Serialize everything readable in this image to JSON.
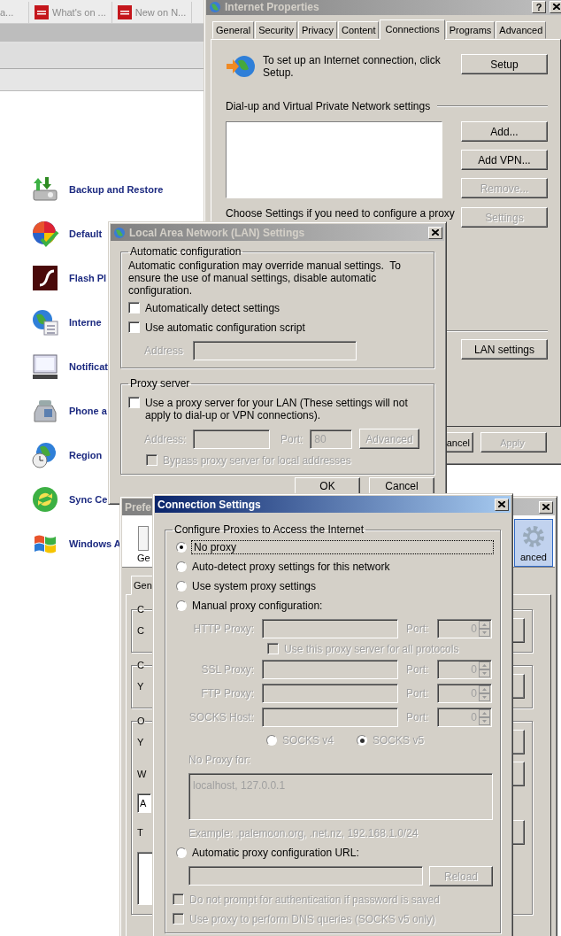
{
  "browser": {
    "tabs": [
      {
        "label": "a...",
        "has_icon": false
      },
      {
        "label": "What's on ...",
        "has_icon": true
      },
      {
        "label": "New on N...",
        "has_icon": true
      }
    ]
  },
  "control_panel": {
    "items": [
      {
        "label": "Backup and Restore"
      },
      {
        "label": "Default"
      },
      {
        "label": "Flash Pl"
      },
      {
        "label": "Interne"
      },
      {
        "label": "Notificat"
      },
      {
        "label": "Phone a"
      },
      {
        "label": "Region"
      },
      {
        "label": "Sync Ce"
      },
      {
        "label": "Windows A"
      }
    ]
  },
  "internet_properties": {
    "title": "Internet Properties",
    "help": "?",
    "active": false,
    "tabs": [
      {
        "label": "General",
        "selected": false
      },
      {
        "label": "Security",
        "selected": false
      },
      {
        "label": "Privacy",
        "selected": false
      },
      {
        "label": "Content",
        "selected": false
      },
      {
        "label": "Connections",
        "selected": true
      },
      {
        "label": "Programs",
        "selected": false
      },
      {
        "label": "Advanced",
        "selected": false
      }
    ],
    "setup_text": "To set up an Internet connection, click Setup.",
    "setup_button": "Setup",
    "vpn_heading": "Dial-up and Virtual Private Network settings",
    "vpn_buttons": [
      {
        "label": "Add...",
        "disabled": false
      },
      {
        "label": "Add VPN...",
        "disabled": false
      },
      {
        "label": "Remove...",
        "disabled": true
      }
    ],
    "proxy_text": "Choose Settings if you need to configure a proxy",
    "settings_button": {
      "label": "Settings",
      "disabled": true
    },
    "lan_button": "LAN settings",
    "footer_buttons": [
      {
        "label": "ancel",
        "disabled": false
      },
      {
        "label": "Apply",
        "disabled": true
      }
    ]
  },
  "lan_settings": {
    "title": "Local Area Network (LAN) Settings",
    "active": false,
    "auto_group": {
      "legend": "Automatic configuration",
      "description": "Automatic configuration may override manual settings.  To ensure the use of manual settings, disable automatic configuration.",
      "options": [
        {
          "label": "Automatically detect settings",
          "checked": false
        },
        {
          "label": "Use automatic configuration script",
          "checked": false
        }
      ],
      "address": {
        "label": "Address",
        "disabled": true
      }
    },
    "proxy_group": {
      "legend": "Proxy server",
      "option": {
        "label": "Use a proxy server for your LAN (These settings will not apply to dial-up or VPN connections).",
        "checked": false
      },
      "address": {
        "label": "Address:",
        "disabled": true
      },
      "port": {
        "label": "Port:",
        "value": "80",
        "disabled": true
      },
      "advanced_button": {
        "label": "Advanced",
        "disabled": true
      },
      "bypass": {
        "label": "Bypass proxy server for local addresses",
        "checked": false,
        "disabled": true
      }
    },
    "buttons": [
      "OK",
      "Cancel"
    ]
  },
  "preferences": {
    "title": "Prefe",
    "active": false,
    "toolbar": [
      {
        "label": "Ge",
        "selected": false
      },
      {
        "label": "anced",
        "selected": true
      }
    ],
    "tab": "Gen",
    "groups": [
      {
        "legend": "C",
        "lines": [
          {
            "kind": "text",
            "text": "C"
          }
        ]
      },
      {
        "legend": "C",
        "lines": [
          {
            "kind": "text",
            "text": "Y"
          }
        ]
      },
      {
        "legend": "O",
        "lines": [
          {
            "kind": "text",
            "text": "Y"
          },
          {
            "kind": "text",
            "text": "W"
          },
          {
            "kind": "field",
            "text": "A"
          },
          {
            "kind": "text",
            "text": "T"
          },
          {
            "kind": "area"
          }
        ]
      }
    ]
  },
  "connection_settings": {
    "title": "Connection Settings",
    "active": true,
    "legend": "Configure Proxies to Access the Internet",
    "modes": [
      {
        "label": "No proxy",
        "selected": true,
        "focused": true
      },
      {
        "label": "Auto-detect proxy settings for this network",
        "selected": false,
        "focused": false
      },
      {
        "label": "Use system proxy settings",
        "selected": false,
        "focused": false
      },
      {
        "label": "Manual proxy configuration:",
        "selected": false,
        "focused": false
      }
    ],
    "manual": {
      "disabled": true,
      "rows": [
        {
          "kind": "proxy",
          "label": "HTTP Proxy:",
          "port_label": "Port:",
          "port": "0"
        },
        {
          "kind": "checkbox",
          "label": "Use this proxy server for all protocols",
          "checked": false
        },
        {
          "kind": "proxy",
          "label": "SSL Proxy:",
          "port_label": "Port:",
          "port": "0"
        },
        {
          "kind": "proxy",
          "label": "FTP Proxy:",
          "port_label": "Port:",
          "port": "0"
        },
        {
          "kind": "proxy",
          "label": "SOCKS Host:",
          "port_label": "Port:",
          "port": "0"
        }
      ],
      "socks_versions": [
        {
          "label": "SOCKS v4",
          "selected": false
        },
        {
          "label": "SOCKS v5",
          "selected": true
        }
      ],
      "no_proxy_label": "No Proxy for:",
      "no_proxy_value": "localhost, 127.0.0.1",
      "example": "Example: .palemoon.org, .net.nz, 192.168.1.0/24"
    },
    "auto_url": {
      "label": "Automatic proxy configuration URL:",
      "selected": false,
      "field_disabled": true,
      "reload": {
        "label": "Reload",
        "disabled": true
      }
    },
    "options_disabled": true,
    "options": [
      {
        "label": "Do not prompt for authentication if password is saved",
        "checked": false
      },
      {
        "label": "Use proxy to perform DNS queries (SOCKS v5 only)",
        "checked": false
      }
    ]
  }
}
